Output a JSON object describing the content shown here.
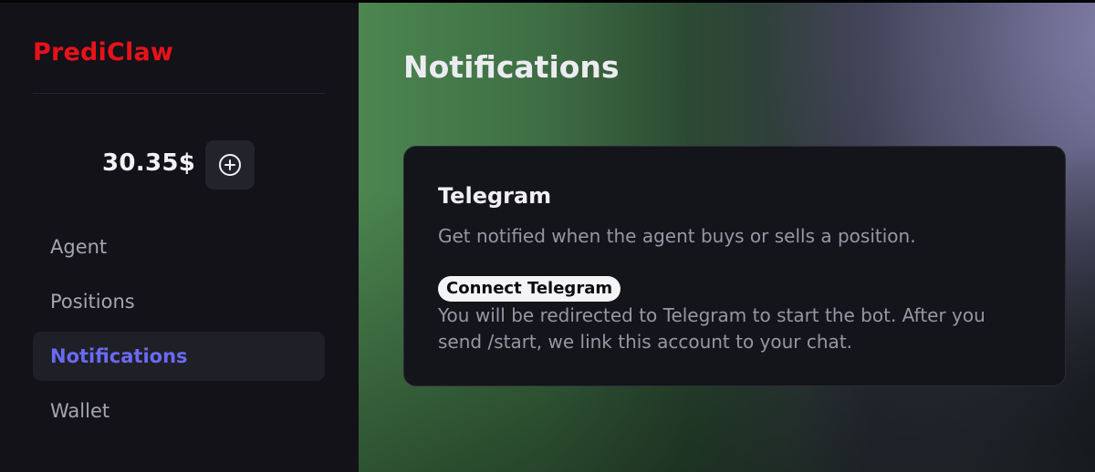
{
  "sidebar": {
    "logo": "PrediClaw",
    "balance": "30.35$",
    "add_funds_icon": "plus-circle-icon",
    "nav": [
      {
        "label": "Agent",
        "active": false
      },
      {
        "label": "Positions",
        "active": false
      },
      {
        "label": "Notifications",
        "active": true
      },
      {
        "label": "Wallet",
        "active": false
      }
    ]
  },
  "main": {
    "title": "Notifications",
    "telegram_card": {
      "title": "Telegram",
      "description": "Get notified when the agent buys or sells a position.",
      "connect_label": "Connect Telegram",
      "note": "You will be redirected to Telegram to start the bot. After you send /start, we link this account to your chat."
    }
  },
  "colors": {
    "brand": "#e8121a",
    "nav_active": "#6b6af4",
    "sidebar_bg": "#121218",
    "card_bg": "#14141b"
  }
}
